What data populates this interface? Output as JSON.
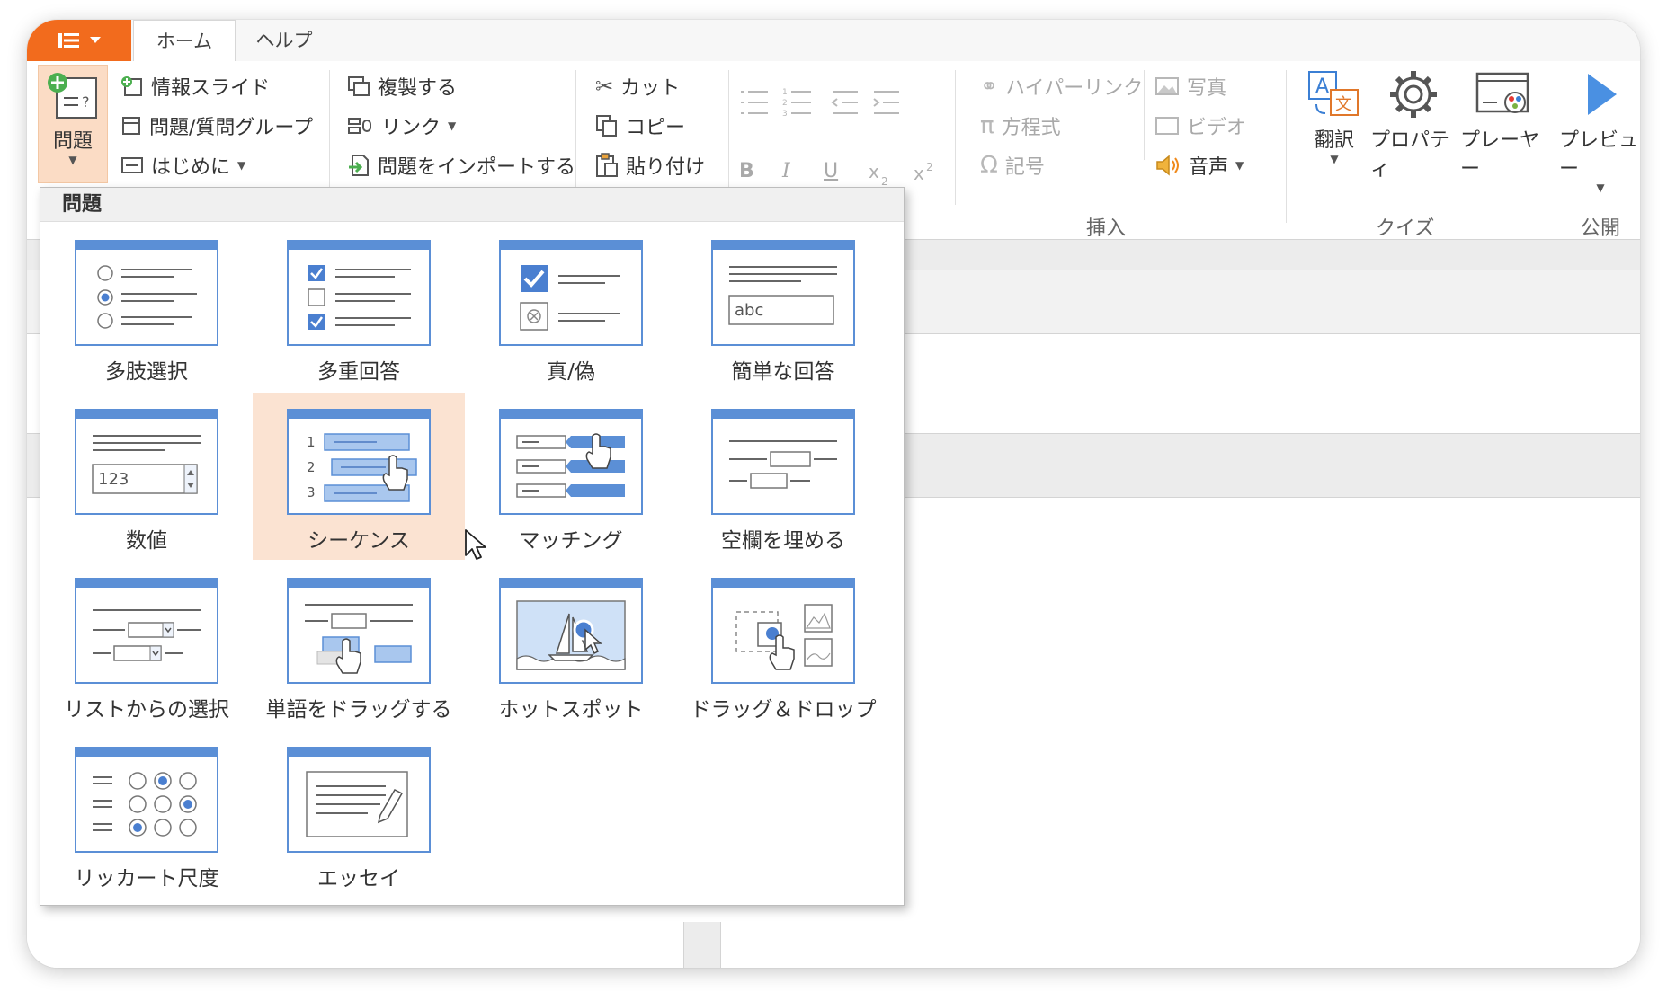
{
  "tabs": [
    {
      "label": "ホーム",
      "active": true
    },
    {
      "label": "ヘルプ",
      "active": false
    }
  ],
  "ribbon": {
    "question_button": "問題",
    "slide_items": [
      "情報スライド",
      "問題/質問グループ",
      "はじめに"
    ],
    "edit_items": [
      "複製する",
      "リンク",
      "問題をインポートする"
    ],
    "clipboard_items": [
      "カット",
      "コピー",
      "貼り付け"
    ],
    "format_letters": [
      "B",
      "I",
      "U"
    ],
    "insert_items": [
      "ハイパーリンク",
      "方程式",
      "記号",
      "写真",
      "ビデオ",
      "音声"
    ],
    "quiz_items": [
      "翻訳",
      "プロパティ",
      "プレーヤー"
    ],
    "publish_items": [
      "プレビュー"
    ],
    "groups": [
      "挿入",
      "クイズ",
      "公開"
    ]
  },
  "dropdown": {
    "header": "問題",
    "items": [
      {
        "label": "多肢選択",
        "icon": "multiple-choice-icon"
      },
      {
        "label": "多重回答",
        "icon": "multiple-response-icon"
      },
      {
        "label": "真/偽",
        "icon": "true-false-icon"
      },
      {
        "label": "簡単な回答",
        "icon": "short-answer-icon"
      },
      {
        "label": "数値",
        "icon": "numeric-icon"
      },
      {
        "label": "シーケンス",
        "icon": "sequence-icon",
        "selected": true
      },
      {
        "label": "マッチング",
        "icon": "matching-icon"
      },
      {
        "label": "空欄を埋める",
        "icon": "fill-in-blank-icon"
      },
      {
        "label": "リストからの選択",
        "icon": "select-from-list-icon"
      },
      {
        "label": "単語をドラッグする",
        "icon": "drag-words-icon"
      },
      {
        "label": "ホットスポット",
        "icon": "hotspot-icon"
      },
      {
        "label": "ドラッグ＆ドロップ",
        "icon": "drag-and-drop-icon"
      },
      {
        "label": "リッカート尺度",
        "icon": "likert-scale-icon"
      },
      {
        "label": "エッセイ",
        "icon": "essay-icon"
      }
    ],
    "icon_text": {
      "abc": "abc",
      "num": "123",
      "seq": [
        "1",
        "2",
        "3"
      ]
    }
  },
  "colors": {
    "accent": "#f26b1d",
    "icon_blue": "#5b8fd6",
    "icon_light": "#a9c7ee",
    "selected_bg": "#fbe3d2"
  }
}
